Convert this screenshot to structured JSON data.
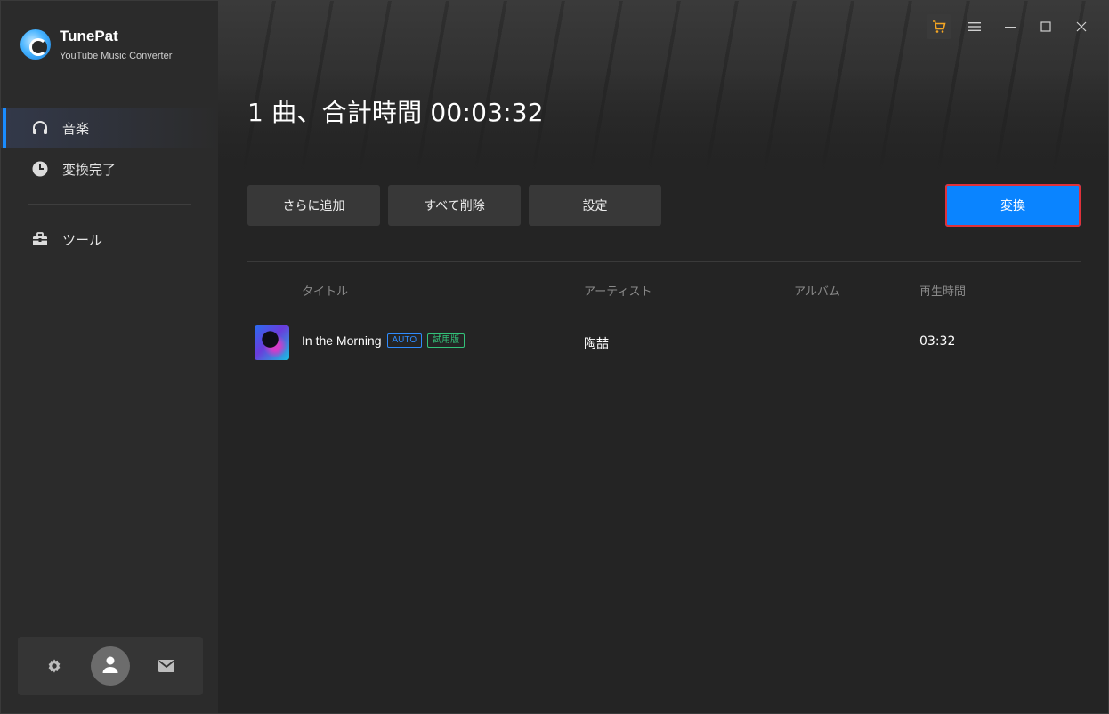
{
  "app": {
    "name": "TunePat",
    "subtitle": "YouTube Music Converter"
  },
  "sidebar": {
    "items": [
      {
        "label": "音楽",
        "icon": "headphones-icon",
        "active": true
      },
      {
        "label": "変換完了",
        "icon": "clock-icon",
        "active": false
      },
      {
        "label": "ツール",
        "icon": "toolbox-icon",
        "active": false
      }
    ],
    "bottom": {
      "settings_icon": "gear-icon",
      "avatar_icon": "user-icon",
      "mail_icon": "mail-icon"
    }
  },
  "window_controls": [
    "cart-icon",
    "menu-icon",
    "minimize-icon",
    "maximize-icon",
    "close-icon"
  ],
  "main": {
    "title": "1 曲、合計時間 00:03:32",
    "buttons": {
      "add": "さらに追加",
      "delete_all": "すべて削除",
      "settings": "設定",
      "convert": "変換"
    },
    "table": {
      "columns": [
        "タイトル",
        "アーティスト",
        "アルバム",
        "再生時間"
      ],
      "rows": [
        {
          "title": "In the Morning",
          "tags": [
            "AUTO",
            "試用版"
          ],
          "artist": "陶喆",
          "album": "",
          "duration": "03:32"
        }
      ]
    }
  },
  "colors": {
    "accent": "#0a84ff",
    "highlight_border": "#e0313a",
    "cart_icon": "#f5a623",
    "tag_auto": "#2f8cff",
    "tag_trial": "#33c27a"
  }
}
